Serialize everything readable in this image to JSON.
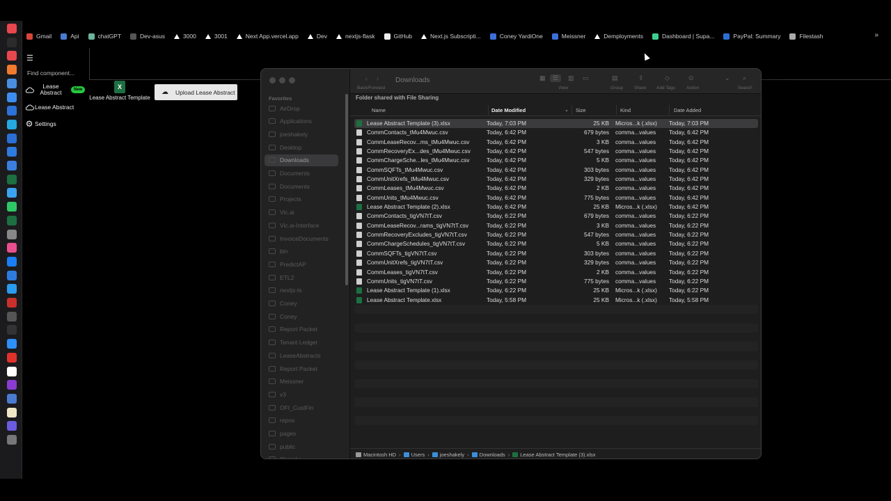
{
  "bookmarks": [
    {
      "label": "Gmail",
      "color": "#d9453a",
      "icon": "gmail-icon"
    },
    {
      "label": "Api",
      "color": "#4a7bd0",
      "icon": "globe-icon"
    },
    {
      "label": "chatGPT",
      "color": "#6bb59a",
      "icon": "chatgpt-icon"
    },
    {
      "label": "Dev-asus",
      "color": "#555555",
      "icon": "blank-icon"
    },
    {
      "label": "3000",
      "color": "#ffffff",
      "icon": "vercel-icon"
    },
    {
      "label": "3001",
      "color": "#ffffff",
      "icon": "vercel-icon"
    },
    {
      "label": "Next App.vercel.app",
      "color": "#ffffff",
      "icon": "vercel-icon"
    },
    {
      "label": "Dev",
      "color": "#ffffff",
      "icon": "vercel-icon"
    },
    {
      "label": "nextjs-flask",
      "color": "#ffffff",
      "icon": "vercel-icon"
    },
    {
      "label": "GitHub",
      "color": "#eeeeee",
      "icon": "github-icon"
    },
    {
      "label": "Next.js Subscripti...",
      "color": "#ffffff",
      "icon": "vercel-icon"
    },
    {
      "label": "Coney YardiOne",
      "color": "#3d6fd9",
      "icon": "yardi-icon"
    },
    {
      "label": "Meissner",
      "color": "#3d6fd9",
      "icon": "yardi-icon"
    },
    {
      "label": "Demployments",
      "color": "#ffffff",
      "icon": "vercel-icon"
    },
    {
      "label": "Dashboard | Supa...",
      "color": "#3ecf8e",
      "icon": "supabase-icon"
    },
    {
      "label": "PayPal: Summary",
      "color": "#2b6fd6",
      "icon": "paypal-icon"
    },
    {
      "label": "Filestash",
      "color": "#aaaaaa",
      "icon": "cloud-icon"
    }
  ],
  "app": {
    "find_placeholder": "Find component...",
    "menu_items": [
      {
        "label": "Lease Abstract",
        "badge": "New"
      },
      {
        "label": "Lease Abstract"
      },
      {
        "label": "Settings"
      }
    ],
    "file_chip_label": "Lease Abstract Template",
    "upload_label": "Upload Lease Abstract"
  },
  "finder": {
    "title": "Downloads",
    "back_forward": "Back/Forward",
    "toolbar": {
      "view": "View",
      "group": "Group",
      "share": "Share",
      "add_tags": "Add Tags",
      "action": "Action",
      "search": "Search"
    },
    "header": "Folder shared with File Sharing",
    "favorites_label": "Favorites",
    "favorites": [
      "AirDrop",
      "Applications",
      "joeshakely",
      "Desktop",
      "Downloads",
      "Documents",
      "Documents",
      "Projects",
      "Vic.ai",
      "Vic.ai-Interface",
      "InvoiceDocuments",
      "bin",
      "PredictAP",
      "ETL2",
      "nextjs-ts",
      "Coney",
      "Coney",
      "Report Packet",
      "Tenant Ledger",
      "LeaseAbstracts",
      "Report Packet",
      "Meissner",
      "v3",
      "OFI_CustFin",
      "repos",
      "pages",
      "public",
      "Sharely"
    ],
    "selected_favorite": 4,
    "columns": {
      "name": "Name",
      "date_modified": "Date Modified",
      "size": "Size",
      "kind": "Kind",
      "date_added": "Date Added"
    },
    "files": [
      {
        "name": "Lease Abstract Template (3).xlsx",
        "modified": "Today, 7:03 PM",
        "size": "25 KB",
        "kind": "Micros...k (.xlsx)",
        "added": "Today, 7:03 PM",
        "type": "xlsx"
      },
      {
        "name": "CommContacts_tMu4Mwuc.csv",
        "modified": "Today, 6:42 PM",
        "size": "679 bytes",
        "kind": "comma...values",
        "added": "Today, 6:42 PM",
        "type": "csv"
      },
      {
        "name": "CommLeaseRecov...ms_tMu4Mwuc.csv",
        "modified": "Today, 6:42 PM",
        "size": "3 KB",
        "kind": "comma...values",
        "added": "Today, 6:42 PM",
        "type": "csv"
      },
      {
        "name": "CommRecoveryEx...des_tMu4Mwuc.csv",
        "modified": "Today, 6:42 PM",
        "size": "547 bytes",
        "kind": "comma...values",
        "added": "Today, 6:42 PM",
        "type": "csv"
      },
      {
        "name": "CommChargeSche...les_tMu4Mwuc.csv",
        "modified": "Today, 6:42 PM",
        "size": "5 KB",
        "kind": "comma...values",
        "added": "Today, 6:42 PM",
        "type": "csv"
      },
      {
        "name": "CommSQFTs_tMu4Mwuc.csv",
        "modified": "Today, 6:42 PM",
        "size": "303 bytes",
        "kind": "comma...values",
        "added": "Today, 6:42 PM",
        "type": "csv"
      },
      {
        "name": "CommUnitXrefs_tMu4Mwuc.csv",
        "modified": "Today, 6:42 PM",
        "size": "329 bytes",
        "kind": "comma...values",
        "added": "Today, 6:42 PM",
        "type": "csv"
      },
      {
        "name": "CommLeases_tMu4Mwuc.csv",
        "modified": "Today, 6:42 PM",
        "size": "2 KB",
        "kind": "comma...values",
        "added": "Today, 6:42 PM",
        "type": "csv"
      },
      {
        "name": "CommUnits_tMu4Mwuc.csv",
        "modified": "Today, 6:42 PM",
        "size": "775 bytes",
        "kind": "comma...values",
        "added": "Today, 6:42 PM",
        "type": "csv"
      },
      {
        "name": "Lease Abstract Template (2).xlsx",
        "modified": "Today, 6:42 PM",
        "size": "25 KB",
        "kind": "Micros...k (.xlsx)",
        "added": "Today, 6:42 PM",
        "type": "xlsx"
      },
      {
        "name": "CommContacts_tigVN7tT.csv",
        "modified": "Today, 6:22 PM",
        "size": "679 bytes",
        "kind": "comma...values",
        "added": "Today, 6:22 PM",
        "type": "csv"
      },
      {
        "name": "CommLeaseRecov...rams_tigVN7tT.csv",
        "modified": "Today, 6:22 PM",
        "size": "3 KB",
        "kind": "comma...values",
        "added": "Today, 6:22 PM",
        "type": "csv"
      },
      {
        "name": "CommRecoveryExcludes_tigVN7tT.csv",
        "modified": "Today, 6:22 PM",
        "size": "547 bytes",
        "kind": "comma...values",
        "added": "Today, 6:22 PM",
        "type": "csv"
      },
      {
        "name": "CommChargeSchedules_tigVN7tT.csv",
        "modified": "Today, 6:22 PM",
        "size": "5 KB",
        "kind": "comma...values",
        "added": "Today, 6:22 PM",
        "type": "csv"
      },
      {
        "name": "CommSQFTs_tigVN7tT.csv",
        "modified": "Today, 6:22 PM",
        "size": "303 bytes",
        "kind": "comma...values",
        "added": "Today, 6:22 PM",
        "type": "csv"
      },
      {
        "name": "CommUnitXrefs_tigVN7tT.csv",
        "modified": "Today, 6:22 PM",
        "size": "329 bytes",
        "kind": "comma...values",
        "added": "Today, 6:22 PM",
        "type": "csv"
      },
      {
        "name": "CommLeases_tigVN7tT.csv",
        "modified": "Today, 6:22 PM",
        "size": "2 KB",
        "kind": "comma...values",
        "added": "Today, 6:22 PM",
        "type": "csv"
      },
      {
        "name": "CommUnits_tigVN7tT.csv",
        "modified": "Today, 6:22 PM",
        "size": "775 bytes",
        "kind": "comma...values",
        "added": "Today, 6:22 PM",
        "type": "csv"
      },
      {
        "name": "Lease Abstract Template (1).xlsx",
        "modified": "Today, 6:22 PM",
        "size": "25 KB",
        "kind": "Micros...k (.xlsx)",
        "added": "Today, 6:22 PM",
        "type": "xlsx"
      },
      {
        "name": "Lease Abstract Template.xlsx",
        "modified": "Today, 5:58 PM",
        "size": "25 KB",
        "kind": "Micros...k (.xlsx)",
        "added": "Today, 5:58 PM",
        "type": "xlsx"
      }
    ],
    "selected_file": 0,
    "path": [
      "Macintosh HD",
      "Users",
      "joeshakely",
      "Downloads",
      "Lease Abstract Template (3).xlsx"
    ]
  },
  "dock_colors": [
    "#e8474e",
    "#2b2b2b",
    "#e8474e",
    "#f07b2f",
    "#4a8ee0",
    "#3d8df0",
    "#2c72d8",
    "#25a9e0",
    "#2b6fd6",
    "#2e7be0",
    "#3a7fe0",
    "#1d6f42",
    "#3ba4f0",
    "#2ec866",
    "#1d6f42",
    "#888888",
    "#e94f8f",
    "#1a7ef5",
    "#2e7be0",
    "#2a9cf0",
    "#c9302c",
    "#555555",
    "#333333",
    "#2e90fa",
    "#e0322c",
    "#ffffff",
    "#8a3bd1",
    "#4a7bd0",
    "#f0e7c7",
    "#6a5be0",
    "#777777"
  ]
}
